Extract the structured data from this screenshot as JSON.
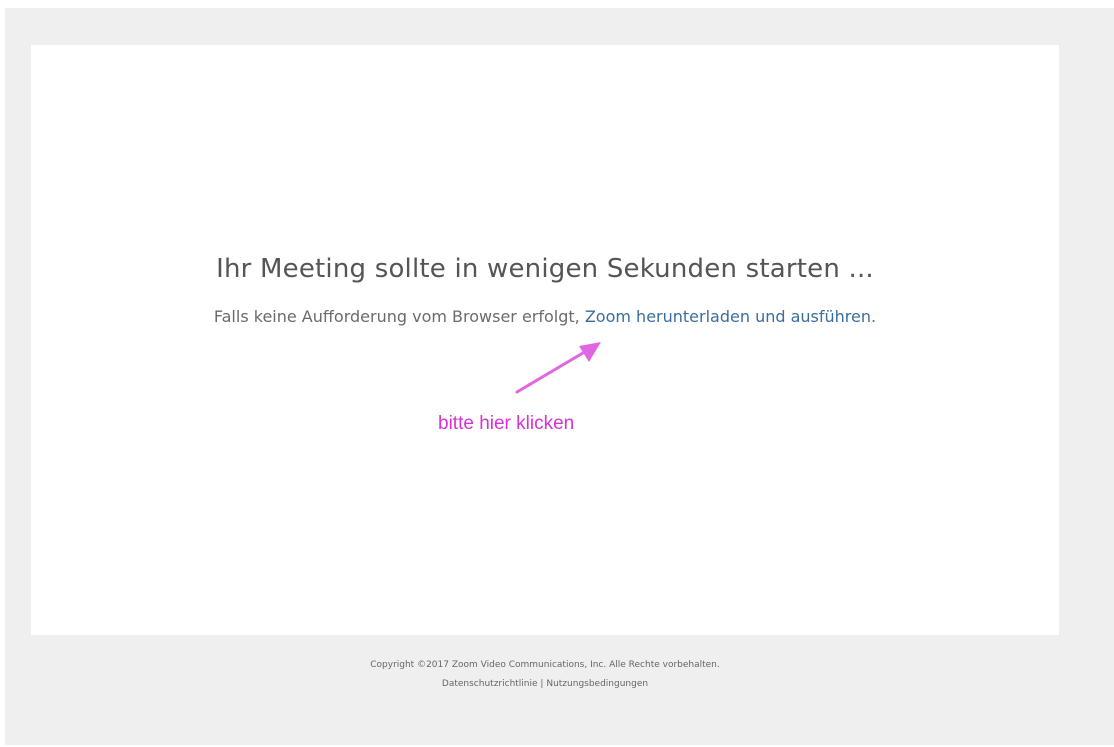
{
  "main": {
    "headline": "Ihr Meeting sollte in wenigen Sekunden starten ...",
    "prompt_text": "Falls keine Aufforderung vom Browser erfolgt,",
    "download_link": "Zoom herunterladen und ausführen",
    "link_suffix": "."
  },
  "annotation": {
    "text": "bitte hier klicken",
    "color": "#d632d6"
  },
  "footer": {
    "copyright": "Copyright ©2017 Zoom Video Communications, Inc. Alle Rechte vorbehalten.",
    "privacy_link": "Datenschutzrichtlinie",
    "separator": "|",
    "terms_link": "Nutzungsbedingungen"
  },
  "colors": {
    "link": "#3a6e9f",
    "background_frame": "#efefef"
  }
}
